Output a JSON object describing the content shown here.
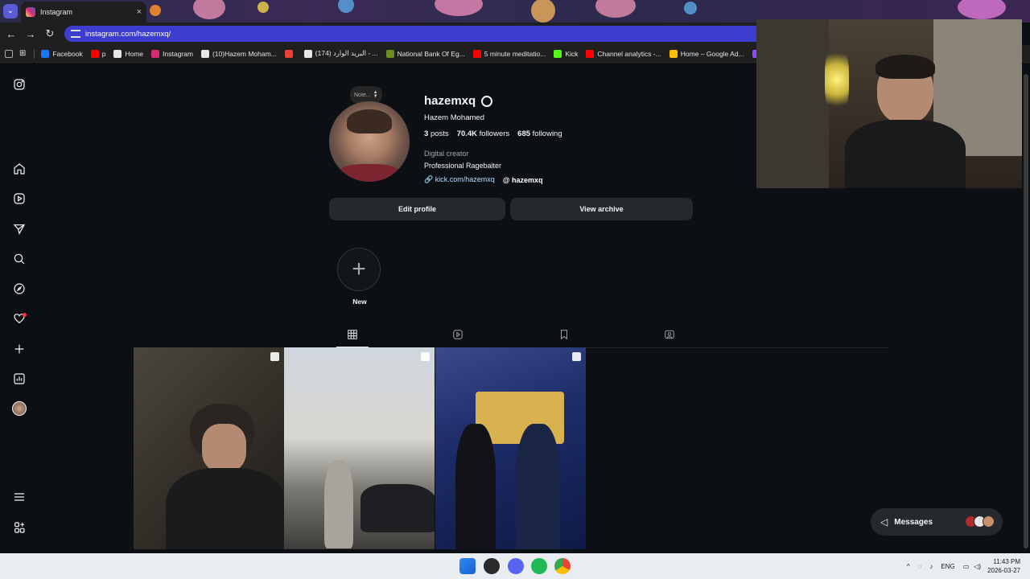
{
  "browser": {
    "tab_title": "Instagram",
    "url": "instagram.com/hazemxq/",
    "bookmarks": [
      {
        "label": "Facebook",
        "color": "#1877f2"
      },
      {
        "label": "p",
        "color": "#ff0000"
      },
      {
        "label": "Home",
        "color": "#e7e7e7"
      },
      {
        "label": "Instagram",
        "color": "#d62976"
      },
      {
        "label": "(10)Hazem Moham...",
        "color": "#e7e7e7"
      },
      {
        "label": "",
        "color": "#ea4335"
      },
      {
        "label": "(174) البريد الوارد - ...",
        "color": "#e7e7e7"
      },
      {
        "label": "National Bank Of Eg...",
        "color": "#6b8e23"
      },
      {
        "label": "5 minute meditatio...",
        "color": "#ff0000"
      },
      {
        "label": "Kick",
        "color": "#53fc18"
      },
      {
        "label": "Channel analytics -...",
        "color": "#ff0000"
      },
      {
        "label": "Home – Google Ad...",
        "color": "#fbbc04"
      },
      {
        "label": "Twi",
        "color": "#9146ff"
      }
    ]
  },
  "profile": {
    "note_label": "Note...",
    "username": "hazemxq",
    "full_name": "Hazem Mohamed",
    "posts_count": "3",
    "posts_label": "posts",
    "followers_count": "70.4K",
    "followers_label": "followers",
    "following_count": "685",
    "following_label": "following",
    "category": "Digital creator",
    "bio": "Professional Ragebaiter",
    "link": "kick.com/hazemxq",
    "threads_handle": "hazemxq",
    "edit_profile_label": "Edit profile",
    "view_archive_label": "View archive",
    "new_story_label": "New"
  },
  "messages": {
    "label": "Messages"
  },
  "taskbar": {
    "language": "ENG",
    "time": "11:43 PM",
    "date": "2026-03-27"
  }
}
